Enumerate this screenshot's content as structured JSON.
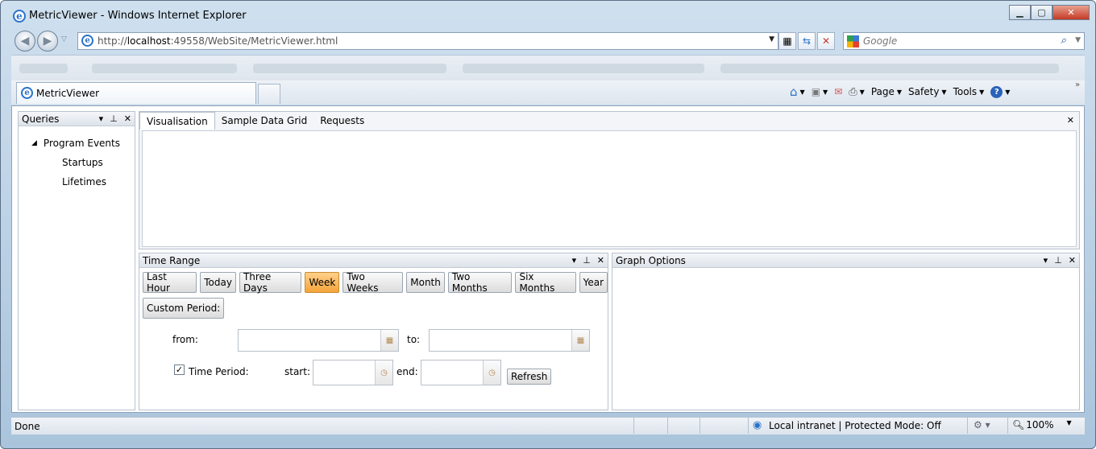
{
  "window": {
    "title": "MetricViewer - Windows Internet Explorer",
    "buttons": {
      "minimize": "▁",
      "maximize": "▢",
      "close": "✕"
    }
  },
  "address_bar": {
    "url_prefix": "http://",
    "url_host": "localhost",
    "url_rest": ":49558/WebSite/MetricViewer.html",
    "search_placeholder": "Google"
  },
  "browser_tab": {
    "label": "MetricViewer"
  },
  "command_bar": {
    "page": "Page",
    "safety": "Safety",
    "tools": "Tools"
  },
  "queries_panel": {
    "title": "Queries",
    "tree": {
      "root": "Program Events",
      "children": [
        "Startups",
        "Lifetimes"
      ]
    }
  },
  "main_tabs": {
    "items": [
      "Visualisation",
      "Sample Data Grid",
      "Requests"
    ],
    "selected": "Visualisation"
  },
  "time_range": {
    "title": "Time Range",
    "buttons": [
      "Last Hour",
      "Today",
      "Three Days",
      "Week",
      "Two Weeks",
      "Month",
      "Two Months",
      "Six Months",
      "Year"
    ],
    "selected": "Week",
    "custom_period": "Custom Period:",
    "from_label": "from:",
    "to_label": "to:",
    "time_period_label": "Time Period:",
    "time_period_checked": true,
    "start_label": "start:",
    "end_label": "end:",
    "refresh": "Refresh"
  },
  "graph_options": {
    "title": "Graph Options"
  },
  "status_bar": {
    "status": "Done",
    "zone": "Local intranet | Protected Mode: Off",
    "zoom": "100%"
  },
  "colors": {
    "selected_button": "#f5a43b",
    "frame": "#a9c4dc"
  }
}
